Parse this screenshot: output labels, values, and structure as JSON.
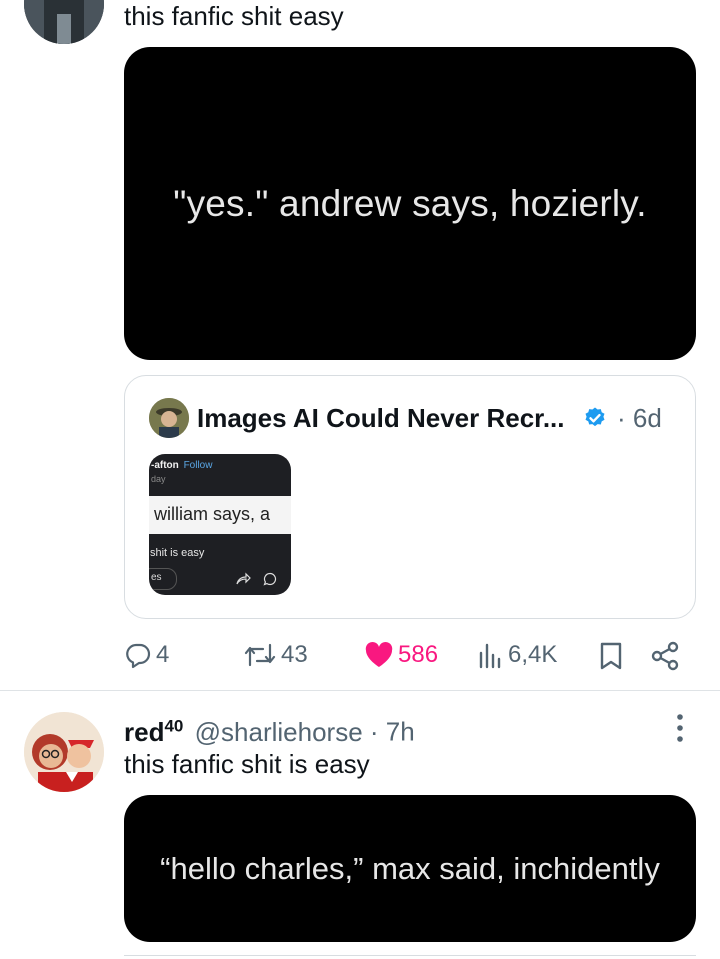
{
  "tweet1": {
    "text": "this fanfic shit easy",
    "media_text": "\"yes.\" andrew says, hozierly.",
    "quote": {
      "account_name": "Images AI Could Never Recr...",
      "time": "· 6d",
      "thumb": {
        "top_name": "-afton",
        "follow": "Follow",
        "sub": "day",
        "quote_line": "william says, a",
        "caption": "shit is easy",
        "pill": "es"
      }
    },
    "actions": {
      "replies": "4",
      "retweets": "43",
      "likes": "586",
      "views": "6,4K"
    },
    "colors": {
      "like": "#f91880",
      "verified": "#1d9bf0"
    }
  },
  "tweet2": {
    "display_name": "red",
    "display_sup": "40",
    "handle": "@sharliehorse",
    "time": "· 7h",
    "text": "this fanfic shit is easy",
    "media_text": "“hello charles,” max said, inchidently"
  }
}
